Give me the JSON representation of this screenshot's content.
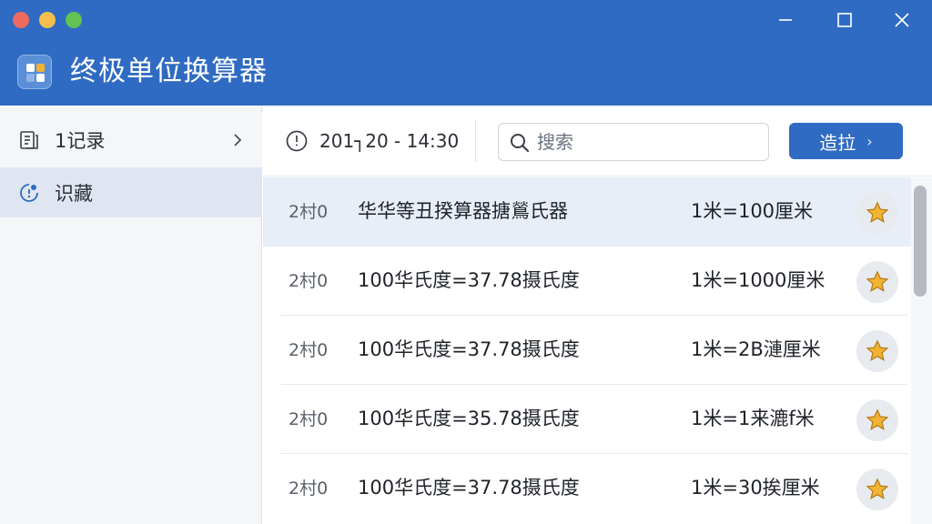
{
  "window": {
    "title": "终极单位换算器"
  },
  "sidebar": {
    "items": [
      {
        "label": "1记录",
        "icon": "history-icon",
        "has_chevron": true
      },
      {
        "label": "识藏",
        "icon": "favorite-icon",
        "selected": true
      }
    ]
  },
  "toolbar": {
    "datetime": "201┐20 - 14:30",
    "search_placeholder": "搜索",
    "add_label": "造拉"
  },
  "list": {
    "rows": [
      {
        "time": "2村0",
        "expression": "华华等丑揆算器搪鶑氏器",
        "result": "1米=100厘米",
        "starred": true,
        "selected": true
      },
      {
        "time": "2村0",
        "expression": "100华氏度=37.78摄氏度",
        "result": "1米=1000厘米",
        "starred": true
      },
      {
        "time": "2村0",
        "expression": "100华氏度=37.78摄氏度",
        "result": "1米=2B漣厘米",
        "starred": true
      },
      {
        "time": "2村0",
        "expression": "100华氏度=35.78摄氏度",
        "result": "1米=1来漉f米",
        "starred": true
      },
      {
        "time": "2村0",
        "expression": "100华氏度=37.78摄氏度",
        "result": "1米=30挨厘米",
        "starred": true
      }
    ]
  },
  "colors": {
    "accent": "#2f6bc2",
    "star": "#f2b233",
    "selected_row": "#e8eef7"
  }
}
